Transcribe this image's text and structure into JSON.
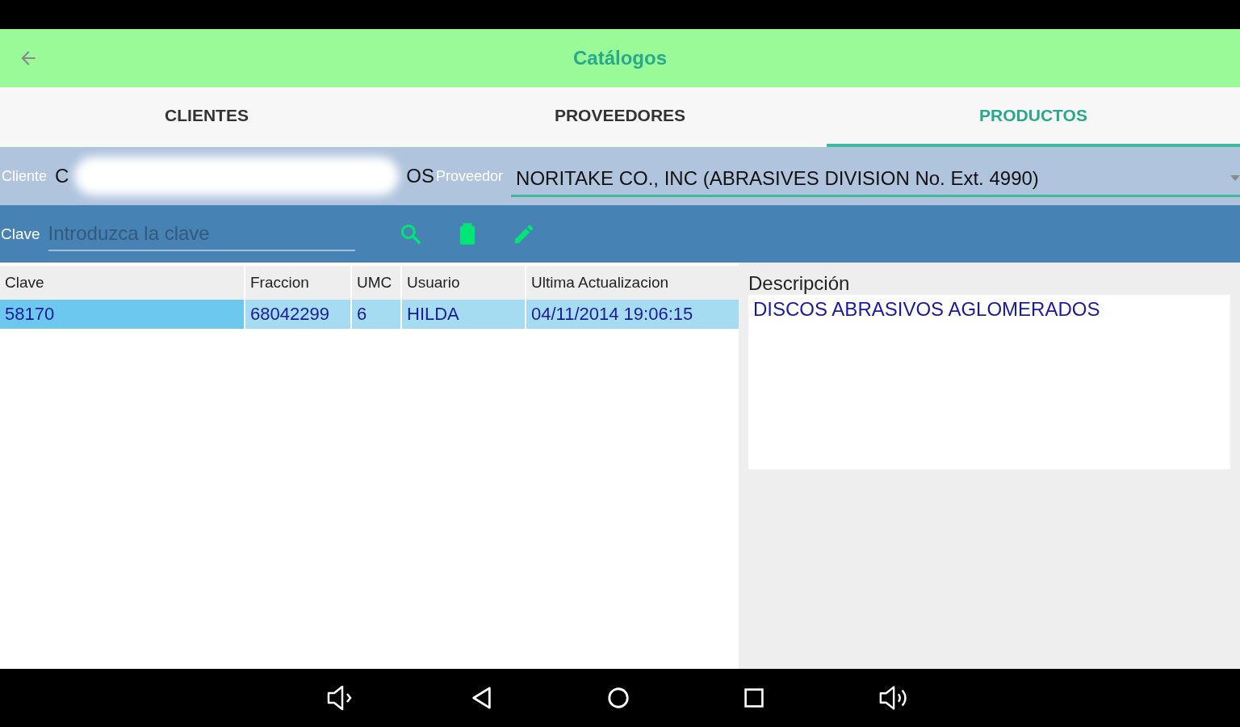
{
  "header": {
    "title": "Catálogos"
  },
  "tabs": [
    {
      "label": "CLIENTES",
      "selected": false
    },
    {
      "label": "PROVEEDORES",
      "selected": false
    },
    {
      "label": "PRODUCTOS",
      "selected": true
    }
  ],
  "filters": {
    "cliente_label": "Cliente",
    "cliente_value_start": "C",
    "cliente_value_end": "OS",
    "cliente_redacted": true,
    "proveedor_label": "Proveedor",
    "proveedor_value": "NORITAKE CO., INC (ABRASIVES DIVISION No. Ext. 4990)"
  },
  "search": {
    "label": "Clave",
    "placeholder": "Introduzca la clave"
  },
  "table": {
    "columns": [
      "Clave",
      "Fraccion",
      "UMC",
      "Usuario",
      "Ultima Actualizacion"
    ],
    "rows": [
      {
        "cells": [
          "58170",
          "68042299",
          "6",
          "HILDA",
          "04/11/2014 19:06:15"
        ],
        "selected": true
      }
    ]
  },
  "description": {
    "label": "Descripción",
    "text": "DISCOS ABRASIVOS AGLOMERADOS"
  }
}
